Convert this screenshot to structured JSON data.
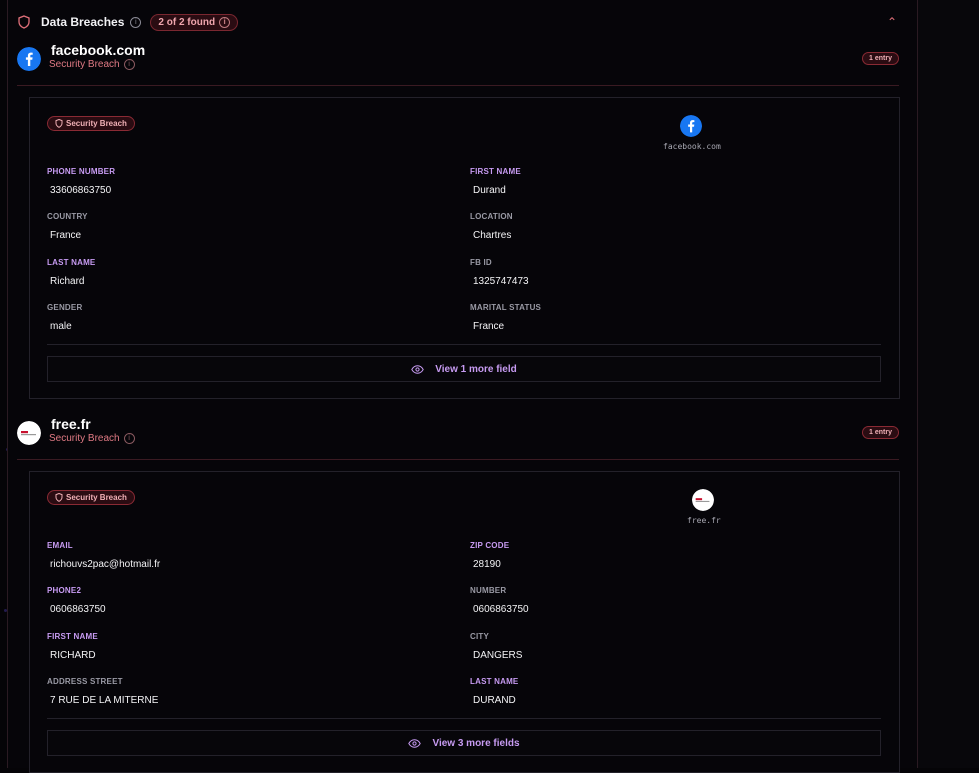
{
  "section": {
    "title": "Data Breaches",
    "found_badge": "2 of 2 found",
    "icon": "shield-icon",
    "accent": "#e0707a",
    "highlight": "#c79bf2"
  },
  "breaches": [
    {
      "site": "facebook.com",
      "subtitle": "Security Breach",
      "entry_badge": "1 entry",
      "tag": "Security Breach",
      "domain_label": "facebook.com",
      "logo": "facebook-logo",
      "fields": [
        {
          "label": "PHONE NUMBER",
          "value": "33606863750",
          "hl": true
        },
        {
          "label": "FIRST NAME",
          "value": "Durand",
          "hl": true
        },
        {
          "label": "COUNTRY",
          "value": "France",
          "hl": false
        },
        {
          "label": "LOCATION",
          "value": "Chartres",
          "hl": false
        },
        {
          "label": "LAST NAME",
          "value": "Richard",
          "hl": true
        },
        {
          "label": "FB ID",
          "value": "1325747473",
          "hl": false
        },
        {
          "label": "GENDER",
          "value": "male",
          "hl": false
        },
        {
          "label": "MARITAL STATUS",
          "value": "France",
          "hl": false
        }
      ],
      "more_label": "View 1 more field"
    },
    {
      "site": "free.fr",
      "subtitle": "Security Breach",
      "entry_badge": "1 entry",
      "tag": "Security Breach",
      "domain_label": "free.fr",
      "logo": "free-logo",
      "fields": [
        {
          "label": "EMAIL",
          "value": "richouvs2pac@hotmail.fr",
          "hl": true
        },
        {
          "label": "ZIP CODE",
          "value": "28190",
          "hl": true
        },
        {
          "label": "PHONE2",
          "value": "0606863750",
          "hl": true
        },
        {
          "label": "NUMBER",
          "value": "0606863750",
          "hl": false
        },
        {
          "label": "FIRST NAME",
          "value": "RICHARD",
          "hl": true
        },
        {
          "label": "CITY",
          "value": "DANGERS",
          "hl": false
        },
        {
          "label": "ADDRESS STREET",
          "value": "7 RUE DE LA MITERNE",
          "hl": false
        },
        {
          "label": "LAST NAME",
          "value": "DURAND",
          "hl": true
        }
      ],
      "more_label": "View 3 more fields"
    }
  ]
}
